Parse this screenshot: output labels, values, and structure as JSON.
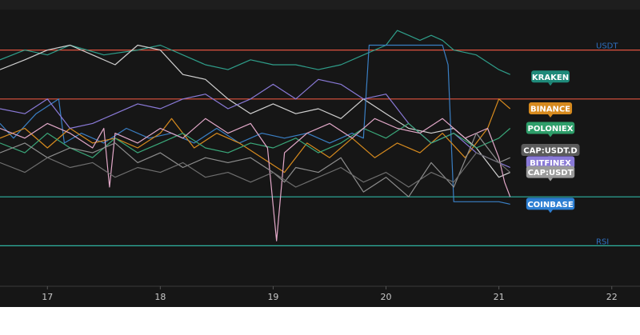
{
  "chart_data": {
    "type": "line",
    "title": "",
    "xlabel": "",
    "ylabel": "",
    "x_ticks": [
      "17",
      "18",
      "19",
      "20",
      "21",
      "22"
    ],
    "xlim": [
      16.58,
      22.25
    ],
    "ylim": [
      0,
      100
    ],
    "horizontal_lines": [
      {
        "label": "USDT",
        "value": 90,
        "color": "#e0533f",
        "label_color": "#2f6fbf"
      },
      {
        "label": "",
        "value": 70,
        "color": "#e0533f",
        "label_color": "#2f6fbf"
      },
      {
        "label": "",
        "value": 30,
        "color": "#2fb3a1",
        "label_color": "#2f6fbf"
      },
      {
        "label": "RSI",
        "value": 10,
        "color": "#2fb3a1",
        "label_color": "#2f6fbf"
      }
    ],
    "badges": [
      {
        "label": "KRAKEN",
        "color": "#1f8a7a",
        "value": 79
      },
      {
        "label": "BINANCE",
        "color": "#d68a1e",
        "value": 66
      },
      {
        "label": "POLONIEX",
        "color": "#2e9e6a",
        "value": 58
      },
      {
        "label": "CAP:USDT.D",
        "color": "#5b5b5b",
        "value": 49
      },
      {
        "label": "BITFINEX",
        "color": "#8a7ad8",
        "value": 44
      },
      {
        "label": "CAP:USDT",
        "color": "#9a9a9a",
        "value": 40
      },
      {
        "label": "COINBASE",
        "color": "#2d7fd3",
        "value": 27
      }
    ],
    "series": [
      {
        "color": "#2f9e8a",
        "x": [
          16.58,
          16.8,
          17.0,
          17.2,
          17.5,
          17.8,
          18.0,
          18.2,
          18.4,
          18.6,
          18.8,
          19.0,
          19.2,
          19.4,
          19.6,
          19.8,
          20.0,
          20.1,
          20.2,
          20.3,
          20.4,
          20.5,
          20.6,
          20.8,
          21.0,
          21.1
        ],
        "values": [
          86,
          90,
          88,
          92,
          88,
          90,
          92,
          88,
          84,
          82,
          86,
          84,
          84,
          82,
          84,
          88,
          92,
          98,
          96,
          94,
          96,
          94,
          90,
          88,
          82,
          80
        ]
      },
      {
        "color": "#d0d0d0",
        "x": [
          16.58,
          16.8,
          17.0,
          17.2,
          17.4,
          17.6,
          17.8,
          18.0,
          18.2,
          18.4,
          18.6,
          18.8,
          19.0,
          19.2,
          19.4,
          19.6,
          19.8,
          20.0,
          20.2,
          20.4,
          20.6,
          20.8,
          21.0,
          21.1
        ],
        "values": [
          82,
          86,
          90,
          92,
          88,
          84,
          92,
          90,
          80,
          78,
          70,
          64,
          68,
          64,
          66,
          62,
          70,
          64,
          58,
          56,
          58,
          50,
          38,
          40
        ]
      },
      {
        "color": "#3a7fc4",
        "x": [
          16.58,
          16.7,
          16.9,
          17.1,
          17.15,
          17.3,
          17.5,
          17.7,
          17.9,
          18.1,
          18.3,
          18.5,
          18.7,
          18.9,
          19.1,
          19.3,
          19.5,
          19.7,
          19.8,
          19.85,
          20.0,
          20.2,
          20.4,
          20.5,
          20.55,
          20.6,
          20.8,
          21.0,
          21.1
        ],
        "values": [
          60,
          54,
          64,
          70,
          52,
          56,
          52,
          58,
          54,
          56,
          52,
          58,
          52,
          56,
          54,
          56,
          52,
          56,
          54,
          92,
          92,
          92,
          92,
          92,
          84,
          28,
          28,
          28,
          27
        ]
      },
      {
        "color": "#d68a1e",
        "x": [
          16.58,
          16.8,
          17.0,
          17.2,
          17.4,
          17.6,
          17.8,
          18.0,
          18.1,
          18.3,
          18.5,
          18.7,
          18.9,
          19.1,
          19.3,
          19.5,
          19.7,
          19.9,
          20.1,
          20.3,
          20.5,
          20.7,
          20.8,
          20.9,
          21.0,
          21.1
        ],
        "values": [
          54,
          58,
          50,
          58,
          52,
          54,
          50,
          56,
          62,
          50,
          56,
          52,
          46,
          40,
          52,
          46,
          54,
          46,
          52,
          48,
          56,
          46,
          52,
          58,
          70,
          66
        ]
      },
      {
        "color": "#8a7ad8",
        "x": [
          16.58,
          16.8,
          17.0,
          17.2,
          17.4,
          17.6,
          17.8,
          18.0,
          18.2,
          18.4,
          18.6,
          18.8,
          19.0,
          19.2,
          19.4,
          19.6,
          19.8,
          20.0,
          20.2,
          20.4,
          20.6,
          20.8,
          21.0,
          21.1
        ],
        "values": [
          66,
          64,
          70,
          58,
          60,
          64,
          68,
          66,
          70,
          72,
          66,
          70,
          76,
          70,
          78,
          76,
          70,
          72,
          60,
          52,
          56,
          48,
          44,
          42
        ]
      },
      {
        "color": "#3aa87a",
        "x": [
          16.58,
          16.8,
          17.0,
          17.2,
          17.4,
          17.6,
          17.8,
          18.0,
          18.2,
          18.4,
          18.6,
          18.8,
          19.0,
          19.2,
          19.4,
          19.6,
          19.8,
          20.0,
          20.2,
          20.4,
          20.6,
          20.8,
          21.0,
          21.1
        ],
        "values": [
          52,
          48,
          56,
          50,
          46,
          54,
          48,
          52,
          56,
          50,
          48,
          52,
          50,
          54,
          48,
          52,
          58,
          54,
          60,
          52,
          56,
          50,
          54,
          58
        ]
      },
      {
        "color": "#e2a8c8",
        "x": [
          16.58,
          16.8,
          17.0,
          17.2,
          17.4,
          17.5,
          17.55,
          17.6,
          17.8,
          18.0,
          18.2,
          18.4,
          18.6,
          18.8,
          18.95,
          19.03,
          19.1,
          19.3,
          19.5,
          19.7,
          19.9,
          20.1,
          20.3,
          20.5,
          20.7,
          20.9,
          21.0,
          21.05,
          21.1
        ],
        "values": [
          58,
          54,
          60,
          56,
          50,
          58,
          34,
          56,
          52,
          58,
          54,
          62,
          56,
          60,
          50,
          12,
          48,
          56,
          60,
          54,
          62,
          58,
          56,
          62,
          54,
          58,
          46,
          36,
          30
        ]
      },
      {
        "color": "#8e8e8e",
        "x": [
          16.58,
          16.8,
          17.0,
          17.2,
          17.4,
          17.6,
          17.8,
          18.0,
          18.2,
          18.4,
          18.6,
          18.8,
          19.0,
          19.1,
          19.2,
          19.4,
          19.6,
          19.8,
          20.0,
          20.2,
          20.4,
          20.6,
          20.8,
          21.0,
          21.1
        ],
        "values": [
          48,
          52,
          46,
          50,
          48,
          52,
          44,
          48,
          42,
          46,
          44,
          46,
          40,
          36,
          42,
          40,
          46,
          32,
          38,
          30,
          44,
          34,
          56,
          44,
          46
        ]
      },
      {
        "color": "#6e6e6e",
        "x": [
          16.58,
          16.8,
          17.0,
          17.2,
          17.4,
          17.6,
          17.8,
          18.0,
          18.2,
          18.4,
          18.6,
          18.8,
          19.0,
          19.2,
          19.4,
          19.6,
          19.8,
          20.0,
          20.2,
          20.4,
          20.6,
          20.8,
          21.0,
          21.1
        ],
        "values": [
          44,
          40,
          46,
          42,
          44,
          38,
          42,
          40,
          44,
          38,
          40,
          36,
          40,
          34,
          38,
          42,
          36,
          40,
          34,
          40,
          36,
          48,
          44,
          40
        ]
      }
    ]
  }
}
